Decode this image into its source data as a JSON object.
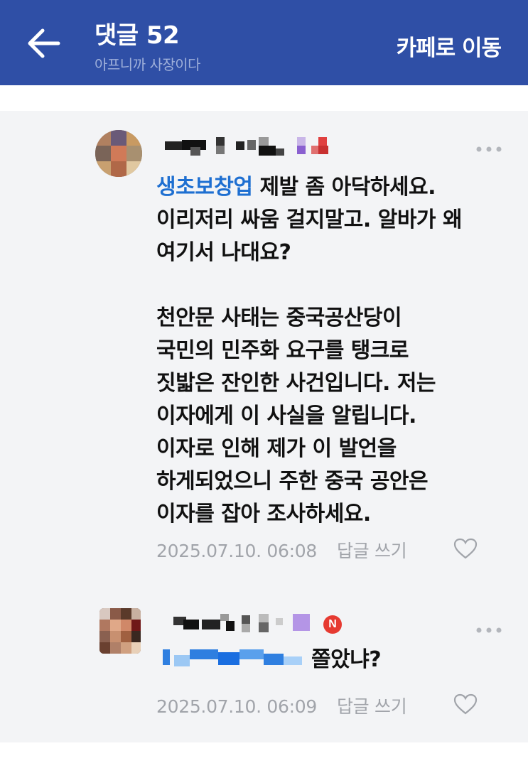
{
  "header": {
    "title": "댓글 52",
    "subtitle": "아프니까 사장이다",
    "cafe_button": "카페로 이동",
    "back_icon": "arrow-left-icon",
    "background": "#2f4fa6"
  },
  "comments": [
    {
      "mention": "생초보창업",
      "text_first": " 제발 좀 아닥하세요.\n이리저리 싸움 걸지말고. 알바가 왜\n여기서 나대요?\n\n천안문 사태는 중국공산당이\n국민의 민주화 요구를 탱크로\n짓밟은 잔인한 사건입니다. 저는\n이자에게 이 사실을 알립니다.\n이자로 인해 제가 이 발언을\n하게되었으니 주한 중국 공안은\n이자를 잡아 조사하세요.",
      "timestamp": "2025.07.10. 06:08",
      "reply_label": "답글 쓰기",
      "more_icon": "more-dots-icon",
      "like_icon": "heart-icon"
    },
    {
      "text": "쫄았냐?",
      "timestamp": "2025.07.10. 06:09",
      "reply_label": "답글 쓰기",
      "badge": "N",
      "more_icon": "more-dots-icon",
      "like_icon": "heart-icon"
    }
  ],
  "colors": {
    "mention": "#1e6fd1",
    "meta": "#a1a4aa",
    "badge": "#e63a31"
  }
}
